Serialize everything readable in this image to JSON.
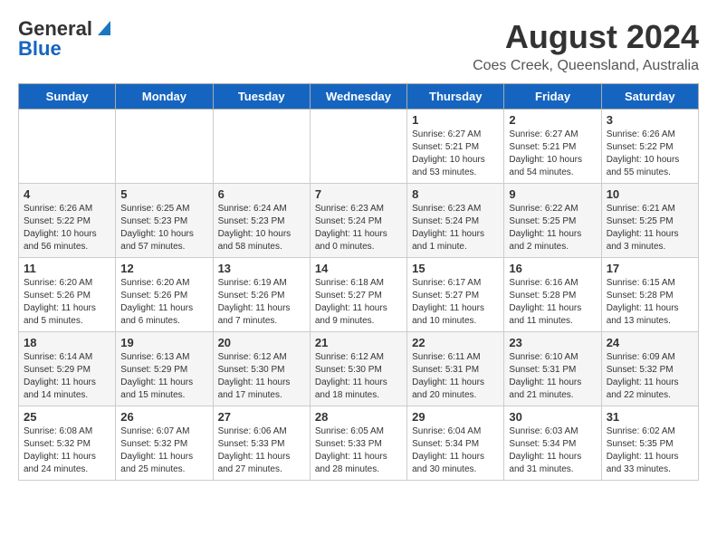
{
  "header": {
    "logo_line1": "General",
    "logo_line2": "Blue",
    "month": "August 2024",
    "location": "Coes Creek, Queensland, Australia"
  },
  "weekdays": [
    "Sunday",
    "Monday",
    "Tuesday",
    "Wednesday",
    "Thursday",
    "Friday",
    "Saturday"
  ],
  "weeks": [
    [
      {
        "day": "",
        "info": ""
      },
      {
        "day": "",
        "info": ""
      },
      {
        "day": "",
        "info": ""
      },
      {
        "day": "",
        "info": ""
      },
      {
        "day": "1",
        "info": "Sunrise: 6:27 AM\nSunset: 5:21 PM\nDaylight: 10 hours\nand 53 minutes."
      },
      {
        "day": "2",
        "info": "Sunrise: 6:27 AM\nSunset: 5:21 PM\nDaylight: 10 hours\nand 54 minutes."
      },
      {
        "day": "3",
        "info": "Sunrise: 6:26 AM\nSunset: 5:22 PM\nDaylight: 10 hours\nand 55 minutes."
      }
    ],
    [
      {
        "day": "4",
        "info": "Sunrise: 6:26 AM\nSunset: 5:22 PM\nDaylight: 10 hours\nand 56 minutes."
      },
      {
        "day": "5",
        "info": "Sunrise: 6:25 AM\nSunset: 5:23 PM\nDaylight: 10 hours\nand 57 minutes."
      },
      {
        "day": "6",
        "info": "Sunrise: 6:24 AM\nSunset: 5:23 PM\nDaylight: 10 hours\nand 58 minutes."
      },
      {
        "day": "7",
        "info": "Sunrise: 6:23 AM\nSunset: 5:24 PM\nDaylight: 11 hours\nand 0 minutes."
      },
      {
        "day": "8",
        "info": "Sunrise: 6:23 AM\nSunset: 5:24 PM\nDaylight: 11 hours\nand 1 minute."
      },
      {
        "day": "9",
        "info": "Sunrise: 6:22 AM\nSunset: 5:25 PM\nDaylight: 11 hours\nand 2 minutes."
      },
      {
        "day": "10",
        "info": "Sunrise: 6:21 AM\nSunset: 5:25 PM\nDaylight: 11 hours\nand 3 minutes."
      }
    ],
    [
      {
        "day": "11",
        "info": "Sunrise: 6:20 AM\nSunset: 5:26 PM\nDaylight: 11 hours\nand 5 minutes."
      },
      {
        "day": "12",
        "info": "Sunrise: 6:20 AM\nSunset: 5:26 PM\nDaylight: 11 hours\nand 6 minutes."
      },
      {
        "day": "13",
        "info": "Sunrise: 6:19 AM\nSunset: 5:26 PM\nDaylight: 11 hours\nand 7 minutes."
      },
      {
        "day": "14",
        "info": "Sunrise: 6:18 AM\nSunset: 5:27 PM\nDaylight: 11 hours\nand 9 minutes."
      },
      {
        "day": "15",
        "info": "Sunrise: 6:17 AM\nSunset: 5:27 PM\nDaylight: 11 hours\nand 10 minutes."
      },
      {
        "day": "16",
        "info": "Sunrise: 6:16 AM\nSunset: 5:28 PM\nDaylight: 11 hours\nand 11 minutes."
      },
      {
        "day": "17",
        "info": "Sunrise: 6:15 AM\nSunset: 5:28 PM\nDaylight: 11 hours\nand 13 minutes."
      }
    ],
    [
      {
        "day": "18",
        "info": "Sunrise: 6:14 AM\nSunset: 5:29 PM\nDaylight: 11 hours\nand 14 minutes."
      },
      {
        "day": "19",
        "info": "Sunrise: 6:13 AM\nSunset: 5:29 PM\nDaylight: 11 hours\nand 15 minutes."
      },
      {
        "day": "20",
        "info": "Sunrise: 6:12 AM\nSunset: 5:30 PM\nDaylight: 11 hours\nand 17 minutes."
      },
      {
        "day": "21",
        "info": "Sunrise: 6:12 AM\nSunset: 5:30 PM\nDaylight: 11 hours\nand 18 minutes."
      },
      {
        "day": "22",
        "info": "Sunrise: 6:11 AM\nSunset: 5:31 PM\nDaylight: 11 hours\nand 20 minutes."
      },
      {
        "day": "23",
        "info": "Sunrise: 6:10 AM\nSunset: 5:31 PM\nDaylight: 11 hours\nand 21 minutes."
      },
      {
        "day": "24",
        "info": "Sunrise: 6:09 AM\nSunset: 5:32 PM\nDaylight: 11 hours\nand 22 minutes."
      }
    ],
    [
      {
        "day": "25",
        "info": "Sunrise: 6:08 AM\nSunset: 5:32 PM\nDaylight: 11 hours\nand 24 minutes."
      },
      {
        "day": "26",
        "info": "Sunrise: 6:07 AM\nSunset: 5:32 PM\nDaylight: 11 hours\nand 25 minutes."
      },
      {
        "day": "27",
        "info": "Sunrise: 6:06 AM\nSunset: 5:33 PM\nDaylight: 11 hours\nand 27 minutes."
      },
      {
        "day": "28",
        "info": "Sunrise: 6:05 AM\nSunset: 5:33 PM\nDaylight: 11 hours\nand 28 minutes."
      },
      {
        "day": "29",
        "info": "Sunrise: 6:04 AM\nSunset: 5:34 PM\nDaylight: 11 hours\nand 30 minutes."
      },
      {
        "day": "30",
        "info": "Sunrise: 6:03 AM\nSunset: 5:34 PM\nDaylight: 11 hours\nand 31 minutes."
      },
      {
        "day": "31",
        "info": "Sunrise: 6:02 AM\nSunset: 5:35 PM\nDaylight: 11 hours\nand 33 minutes."
      }
    ]
  ]
}
